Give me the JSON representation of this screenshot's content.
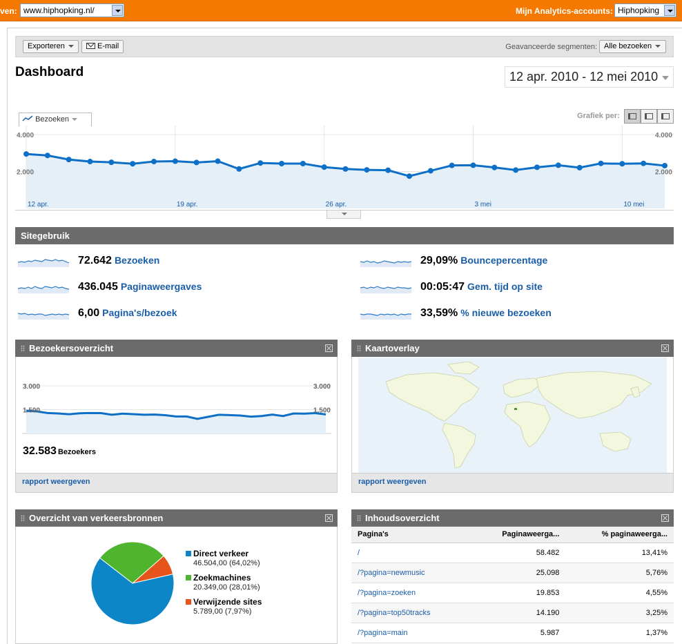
{
  "topbar": {
    "view_label": "ven:",
    "site_select": "www.hiphopking.nl/",
    "accounts_label": "Mijn Analytics-accounts:",
    "account_select": "Hiphopking"
  },
  "toolbar": {
    "export_label": "Exporteren",
    "email_label": "E-mail",
    "segments_label": "Geavanceerde segmenten:",
    "segments_select": "Alle bezoeken"
  },
  "page_title": "Dashboard",
  "date_range": "12 apr. 2010 - 12 mei 2010",
  "main_chart": {
    "metric_tab": "Bezoeken",
    "grafiek_label": "Grafiek per:",
    "ytick_top": "4.000",
    "ytick_mid": "2.000",
    "xlabels": [
      "12 apr.",
      "19 apr.",
      "26 apr.",
      "3 mei",
      "10 mei"
    ]
  },
  "site_usage": {
    "title": "Sitegebruik",
    "metrics": [
      {
        "value": "72.642",
        "label": "Bezoeken"
      },
      {
        "value": "436.045",
        "label": "Paginaweergaves"
      },
      {
        "value": "6,00",
        "label": "Pagina's/bezoek"
      },
      {
        "value": "29,09%",
        "label": "Bouncepercentage"
      },
      {
        "value": "00:05:47",
        "label": "Gem. tijd op site"
      },
      {
        "value": "33,59%",
        "label": "% nieuwe bezoeken"
      }
    ]
  },
  "visitors_panel": {
    "title": "Bezoekersoverzicht",
    "ytick_top": "3.000",
    "ytick_mid": "1.500",
    "visitors_value": "32.583",
    "visitors_label": "Bezoekers",
    "report_link": "rapport weergeven"
  },
  "map_panel": {
    "title": "Kaartoverlay",
    "report_link": "rapport weergeven"
  },
  "traffic_panel": {
    "title": "Overzicht van verkeersbronnen"
  },
  "content_panel": {
    "title": "Inhoudsoverzicht",
    "columns": [
      "Pagina's",
      "Paginaweergа...",
      "% paginaweergа..."
    ],
    "rows": [
      {
        "page": "/",
        "views": "58.482",
        "pct": "13,41%"
      },
      {
        "page": "/?pagina=newmusic",
        "views": "25.098",
        "pct": "5,76%"
      },
      {
        "page": "/?pagina=zoeken",
        "views": "19.853",
        "pct": "4,55%"
      },
      {
        "page": "/?pagina=top50tracks",
        "views": "14.190",
        "pct": "3,25%"
      },
      {
        "page": "/?pagina=main",
        "views": "5.987",
        "pct": "1,37%"
      }
    ]
  },
  "colors": {
    "brand_orange": "#f57900",
    "series_blue": "#0d6fc6",
    "link_blue": "#1a5da8",
    "panel_header": "#6b6b6b"
  },
  "chart_data": [
    {
      "type": "line",
      "title": "",
      "series": [
        {
          "name": "Bezoeken",
          "values": [
            2950,
            2870,
            2650,
            2540,
            2500,
            2420,
            2540,
            2560,
            2490,
            2560,
            2140,
            2460,
            2430,
            2430,
            2240,
            2140,
            2090,
            2070,
            1750,
            2040,
            2330,
            2340,
            2220,
            2080,
            2230,
            2340,
            2210,
            2440,
            2420,
            2440,
            2320
          ]
        }
      ],
      "x": [
        "12 apr.",
        "",
        "",
        "",
        "",
        "",
        "",
        "19 apr.",
        "",
        "",
        "",
        "",
        "",
        "",
        "26 apr.",
        "",
        "",
        "",
        "",
        "",
        "",
        "3 mei",
        "",
        "",
        "",
        "",
        "",
        "",
        "10 mei",
        "",
        ""
      ],
      "ylim": [
        0,
        4000
      ],
      "yticks": [
        "2.000",
        "4.000"
      ],
      "grid": true
    },
    {
      "type": "line",
      "title": "",
      "series": [
        {
          "name": "Bezoekers",
          "values": [
            1430,
            1390,
            1290,
            1260,
            1210,
            1270,
            1290,
            1280,
            1180,
            1250,
            1220,
            1180,
            1190,
            1150,
            1070,
            1070,
            920,
            1050,
            1180,
            1160,
            1130,
            1060,
            1100,
            1190,
            1100,
            1260,
            1250,
            1280,
            1200
          ]
        }
      ],
      "ylim": [
        0,
        3000
      ],
      "yticks": [
        "1.500",
        "3.000"
      ]
    },
    {
      "type": "pie",
      "labels": [
        "Direct verkeer",
        "Zoekmachines",
        "Verwijzende sites"
      ],
      "values": [
        46504,
        20349,
        5789
      ],
      "value_labels": [
        "46.504,00 (64,02%)",
        "20.349,00 (28,01%)",
        "5.789,00 (7,97%)"
      ],
      "colors": [
        "#0d86c8",
        "#4fb52e",
        "#e6541b"
      ]
    }
  ]
}
